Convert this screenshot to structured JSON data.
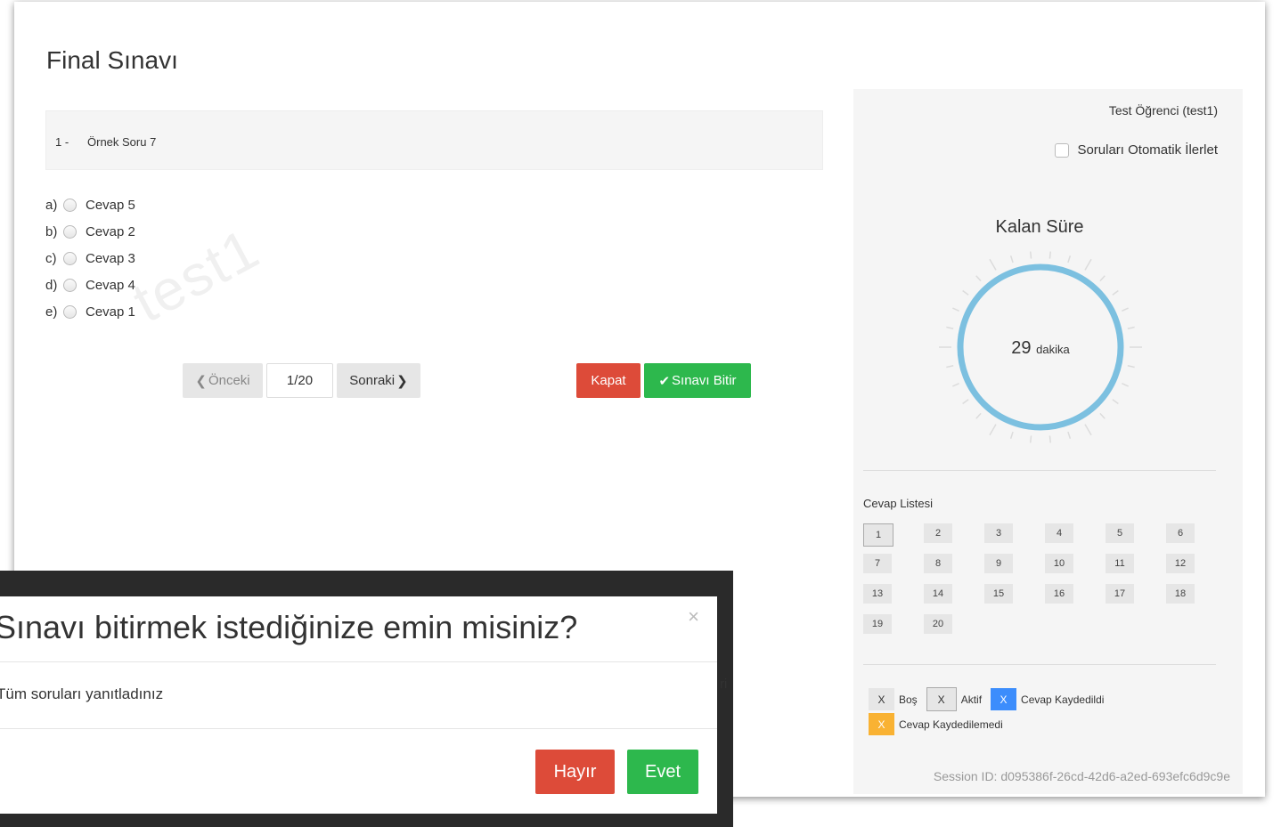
{
  "exam": {
    "title": "Final Sınavı",
    "question_number": "1 -",
    "question_text": "Örnek Soru 7",
    "watermark": "test1",
    "answers": [
      {
        "letter": "a)",
        "label": "Cevap 5"
      },
      {
        "letter": "b)",
        "label": "Cevap 2"
      },
      {
        "letter": "c)",
        "label": "Cevap 3"
      },
      {
        "letter": "d)",
        "label": "Cevap 4"
      },
      {
        "letter": "e)",
        "label": "Cevap 1"
      }
    ],
    "prev_label": "Önceki",
    "page_indicator": "1/20",
    "next_label": "Sonraki",
    "close_label": "Kapat",
    "finish_label": "Sınavı Bitir"
  },
  "side": {
    "student": "Test Öğrenci (test1)",
    "auto_advance_label": "Soruları Otomatik İlerlet",
    "remaining_title": "Kalan Süre",
    "remaining_minutes": "29",
    "remaining_unit": "dakika",
    "answer_list_title": "Cevap Listesi",
    "answer_numbers": [
      "1",
      "2",
      "3",
      "4",
      "5",
      "6",
      "7",
      "8",
      "9",
      "10",
      "11",
      "12",
      "13",
      "14",
      "15",
      "16",
      "17",
      "18",
      "19",
      "20"
    ],
    "active_number": "1",
    "legend": {
      "mark": "X",
      "empty": "Boş",
      "active": "Aktif",
      "saved": "Cevap Kaydedildi",
      "not_saved": "Cevap Kaydedilemedi"
    },
    "session": "Session ID: d095386f-26cd-42d6-a2ed-693efc6d9c9e"
  },
  "modal": {
    "title": "Sınavı bitirmek istediğinize emin misiniz?",
    "close_symbol": "×",
    "body": "Tüm soruları yanıtladınız",
    "no_label": "Hayır",
    "yes_label": "Evet"
  },
  "colors": {
    "danger": "#dd4b39",
    "success": "#2db84d",
    "timer_ring": "#7cc0e0",
    "saved": "#3c8dfc",
    "not_saved": "#f9b233"
  }
}
